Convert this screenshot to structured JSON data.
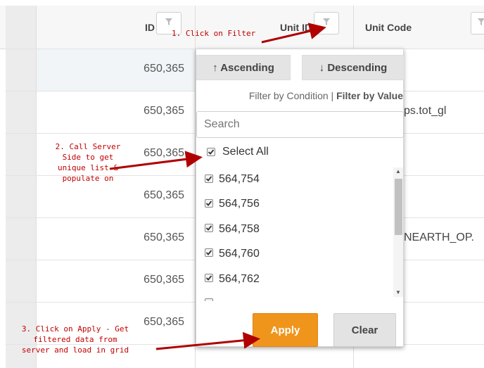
{
  "grid": {
    "columns": [
      {
        "label": "ID"
      },
      {
        "label": "Unit ID"
      },
      {
        "label": "Unit Code"
      }
    ],
    "rows": [
      {
        "id": "650,365",
        "unit_code": ""
      },
      {
        "id": "650,365",
        "unit_code": "ps.tot_gl"
      },
      {
        "id": "650,365",
        "unit_code": ""
      },
      {
        "id": "650,365",
        "unit_code": ""
      },
      {
        "id": "650,365",
        "unit_code": "NEARTH_OP."
      },
      {
        "id": "650,365",
        "unit_code": ""
      },
      {
        "id": "650,365",
        "unit_code": ""
      }
    ]
  },
  "filter_panel": {
    "sort_ascending": "↑ Ascending",
    "sort_descending": "↓ Descending",
    "filter_by_condition": "Filter by Condition",
    "separator": "|",
    "filter_by_value": "Filter by Value",
    "search_placeholder": "Search",
    "select_all": "Select All",
    "values": [
      "564,754",
      "564,756",
      "564,758",
      "564,760",
      "564,762"
    ],
    "apply_label": "Apply",
    "clear_label": "Clear"
  },
  "annotations": {
    "step1": "1. Click on Filter",
    "step2_lines": [
      "2. Call Server",
      "Side to get",
      "unique list &",
      "populate on"
    ],
    "step3_lines": [
      "3. Click on Apply - Get",
      "filtered data from",
      "server and load in grid"
    ]
  },
  "colors": {
    "apply_button": "#f0951c",
    "annotation": "#c00000"
  }
}
